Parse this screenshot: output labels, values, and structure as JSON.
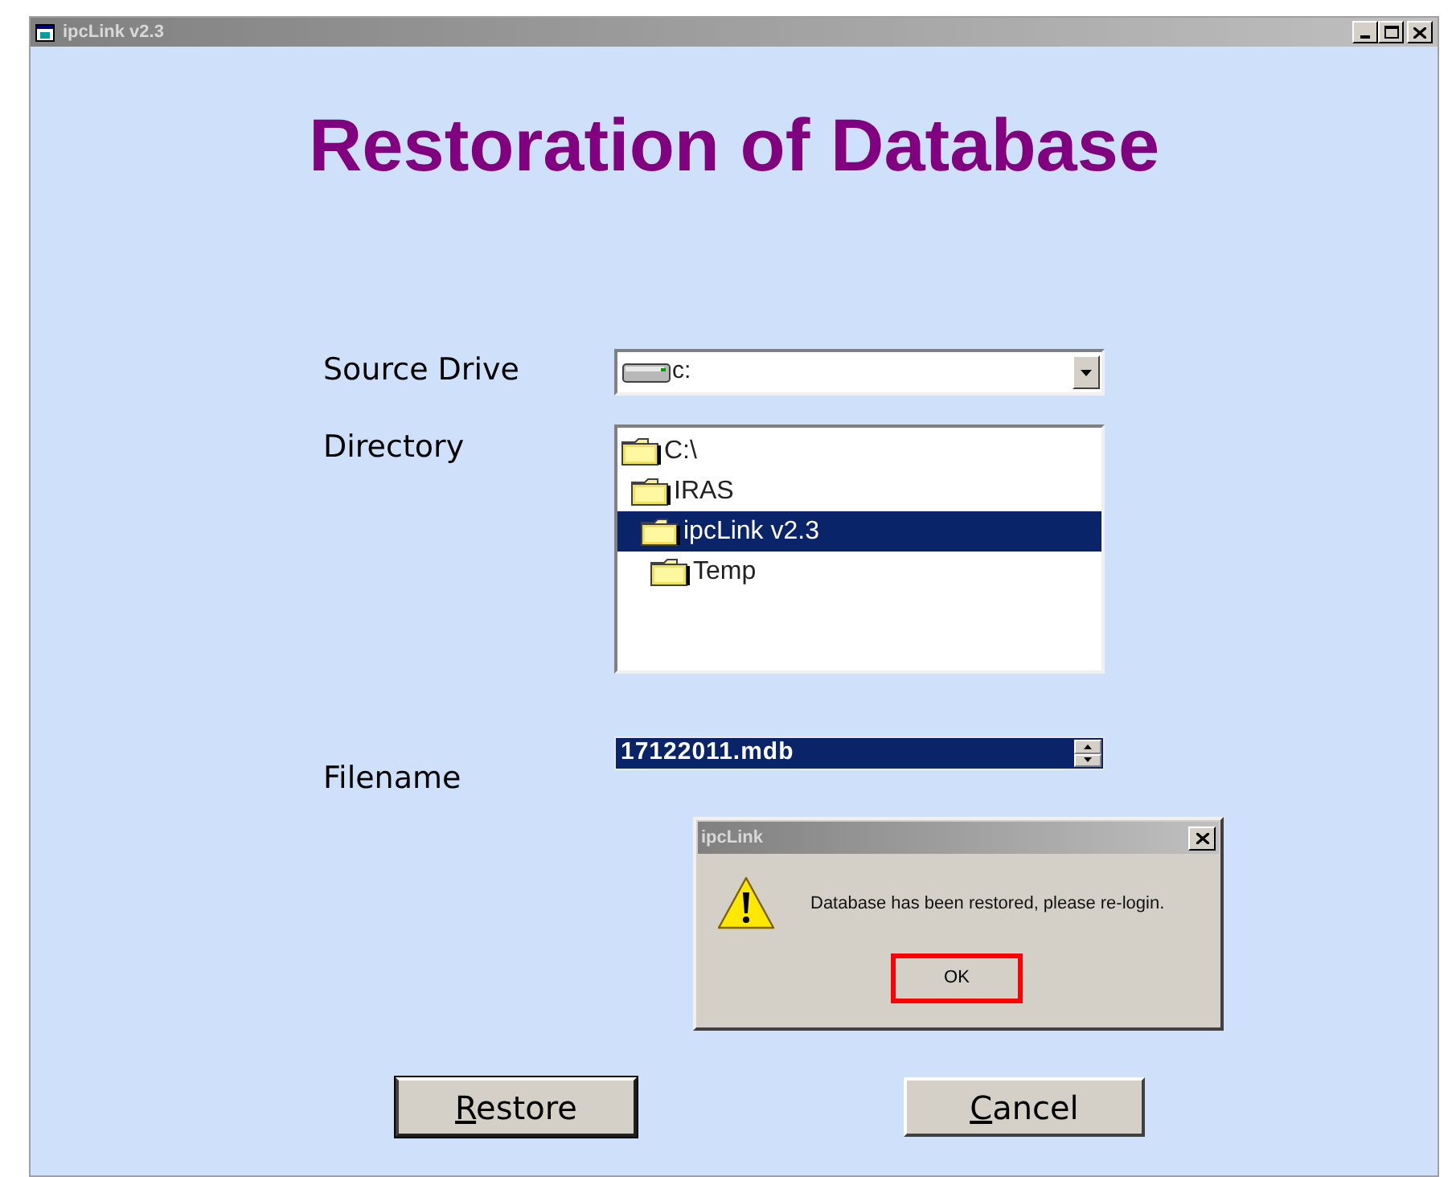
{
  "window": {
    "title": "ipcLink v2.3"
  },
  "heading": "Restoration of Database",
  "source_drive": {
    "label": "Source Drive",
    "value": "c:"
  },
  "directory": {
    "label": "Directory",
    "tree": [
      {
        "label": "C:\\",
        "selected": false,
        "children": [
          {
            "label": "IRAS",
            "selected": false,
            "children": [
              {
                "label": "ipcLink v2.3",
                "selected": true,
                "children": [
                  {
                    "label": "Temp",
                    "selected": false
                  }
                ]
              }
            ]
          }
        ]
      }
    ]
  },
  "filename": {
    "label": "Filename",
    "value": "17122011.mdb",
    "selected": true
  },
  "buttons": [
    {
      "label": "Restore",
      "accel_first": true
    },
    {
      "label": "Cancel",
      "accel_first": true
    }
  ],
  "dialog": {
    "title": "ipcLink",
    "message": "Database has been restored, please re-login.",
    "button": {
      "label": "OK",
      "highlighted": true
    }
  }
}
